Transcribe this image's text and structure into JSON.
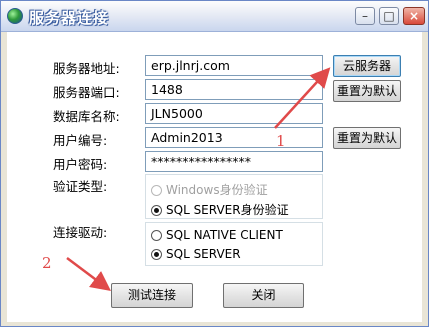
{
  "window": {
    "title": "服务器连接"
  },
  "labels": {
    "server_address": "服务器地址:",
    "server_port": "服务器端口:",
    "database_name": "数据库名称:",
    "user_id": "用户编号:",
    "user_password": "用户密码:",
    "auth_type": "验证类型:",
    "connection_driver": "连接驱动:"
  },
  "fields": {
    "server_address": "erp.jlnrj.com",
    "server_port": "1488",
    "database_name": "JLN5000",
    "user_id": "Admin2013",
    "user_password": "****************"
  },
  "buttons": {
    "cloud_server": "云服务器",
    "reset_default_1": "重置为默认",
    "reset_default_2": "重置为默认",
    "test_connection": "测试连接",
    "close": "关闭"
  },
  "auth_options": [
    {
      "label": "Windows身份验证",
      "checked": false,
      "disabled": true
    },
    {
      "label": "SQL SERVER身份验证",
      "checked": true,
      "disabled": false
    }
  ],
  "driver_options": [
    {
      "label": "SQL NATIVE CLIENT",
      "checked": false
    },
    {
      "label": "SQL SERVER",
      "checked": true
    }
  ],
  "annotations": {
    "one": "1",
    "two": "2"
  },
  "colors": {
    "annotation_red": "#e04a4a",
    "titlebar_text": "#ffffff"
  }
}
